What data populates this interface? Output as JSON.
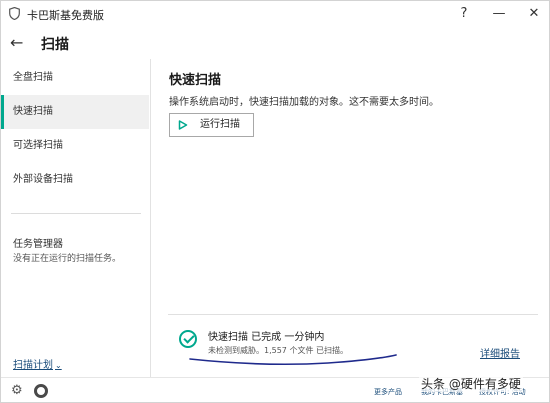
{
  "titlebar": {
    "app_title": "卡巴斯基免费版",
    "help": "?",
    "minimize": "—",
    "close": "✕"
  },
  "header": {
    "back": "←",
    "title": "扫描"
  },
  "sidebar": {
    "items": [
      {
        "label": "全盘扫描",
        "active": false
      },
      {
        "label": "快速扫描",
        "active": true
      },
      {
        "label": "可选择扫描",
        "active": false
      },
      {
        "label": "外部设备扫描",
        "active": false
      }
    ],
    "task_manager_title": "任务管理器",
    "task_manager_sub": "没有正在运行的扫描任务。",
    "schedule_link": "扫描计划",
    "schedule_chevron": "⌄"
  },
  "main": {
    "title": "快速扫描",
    "description": "操作系统启动时，快速扫描加载的对象。这不需要太多时间。",
    "run_button": "运行扫描"
  },
  "status": {
    "title": "快速扫描 已完成 一分钟内",
    "subtitle": "未检测到威胁。1,557 个文件 已扫描。",
    "detail_link": "详细报告"
  },
  "bottombar": {
    "more_products": "更多产品",
    "my_kaspersky": "我的卡巴斯基",
    "license": "授权许可: 活动"
  },
  "watermark": "头条 @硬件有多硬",
  "colors": {
    "accent": "#00a88e",
    "link": "#1a4c7a",
    "annotation": "#1f2a8c"
  }
}
